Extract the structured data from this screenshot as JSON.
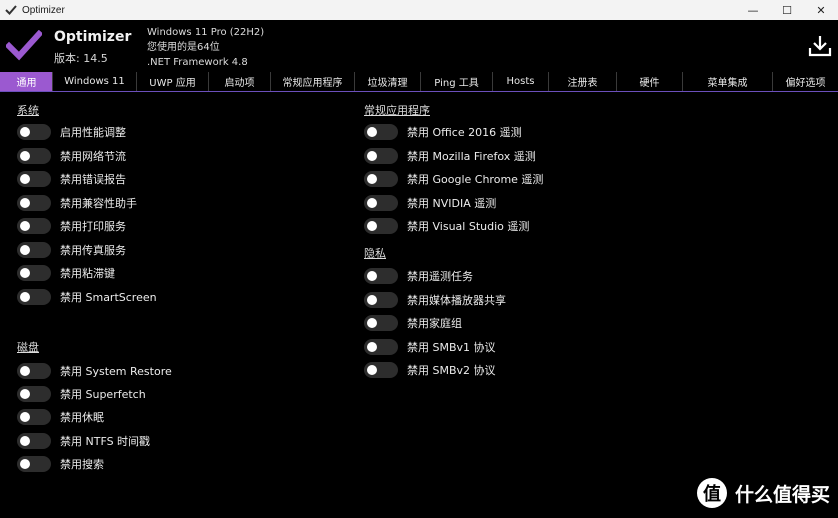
{
  "window": {
    "title": "Optimizer",
    "minimize_glyph": "—",
    "maximize_glyph": "☐",
    "close_glyph": "✕"
  },
  "header": {
    "app_name": "Optimizer",
    "version": "版本: 14.5",
    "os": "Windows 11 Pro (22H2)",
    "arch": "您使用的是64位",
    "framework": ".NET Framework 4.8",
    "accent_color": "#9b59d0"
  },
  "tabs": [
    {
      "label": "通用",
      "active": true
    },
    {
      "label": "Windows 11",
      "active": false
    },
    {
      "label": "UWP 应用",
      "active": false
    },
    {
      "label": "启动项",
      "active": false
    },
    {
      "label": "常规应用程序",
      "active": false
    },
    {
      "label": "垃圾清理",
      "active": false
    },
    {
      "label": "Ping 工具",
      "active": false
    },
    {
      "label": "Hosts",
      "active": false
    },
    {
      "label": "注册表",
      "active": false
    },
    {
      "label": "硬件",
      "active": false
    },
    {
      "label": "菜单集成",
      "active": false
    },
    {
      "label": "偏好选项",
      "active": false
    }
  ],
  "sections": {
    "system": {
      "title": "系统",
      "options": [
        {
          "label": "启用性能调整",
          "on": false
        },
        {
          "label": "禁用网络节流",
          "on": false
        },
        {
          "label": "禁用错误报告",
          "on": false
        },
        {
          "label": "禁用兼容性助手",
          "on": false
        },
        {
          "label": "禁用打印服务",
          "on": false
        },
        {
          "label": "禁用传真服务",
          "on": false
        },
        {
          "label": "禁用粘滞键",
          "on": false
        },
        {
          "label": "禁用 SmartScreen",
          "on": false
        }
      ]
    },
    "disk": {
      "title": "磁盘",
      "options": [
        {
          "label": "禁用 System Restore",
          "on": false
        },
        {
          "label": "禁用 Superfetch",
          "on": false
        },
        {
          "label": "禁用休眠",
          "on": false
        },
        {
          "label": "禁用 NTFS 时间戳",
          "on": false
        },
        {
          "label": "禁用搜索",
          "on": false
        }
      ]
    },
    "apps": {
      "title": "常规应用程序",
      "options": [
        {
          "label": "禁用 Office 2016 遥测",
          "on": false
        },
        {
          "label": "禁用 Mozilla Firefox 遥测",
          "on": false
        },
        {
          "label": "禁用 Google Chrome 遥测",
          "on": false
        },
        {
          "label": "禁用 NVIDIA 遥测",
          "on": false
        },
        {
          "label": "禁用 Visual Studio 遥测",
          "on": false
        }
      ]
    },
    "privacy": {
      "title": "隐私",
      "options": [
        {
          "label": "禁用遥测任务",
          "on": false
        },
        {
          "label": "禁用媒体播放器共享",
          "on": false
        },
        {
          "label": "禁用家庭组",
          "on": false
        },
        {
          "label": "禁用 SMBv1 协议",
          "on": false
        },
        {
          "label": "禁用 SMBv2 协议",
          "on": false
        }
      ]
    }
  },
  "watermark": {
    "badge": "值",
    "text": "什么值得买"
  }
}
